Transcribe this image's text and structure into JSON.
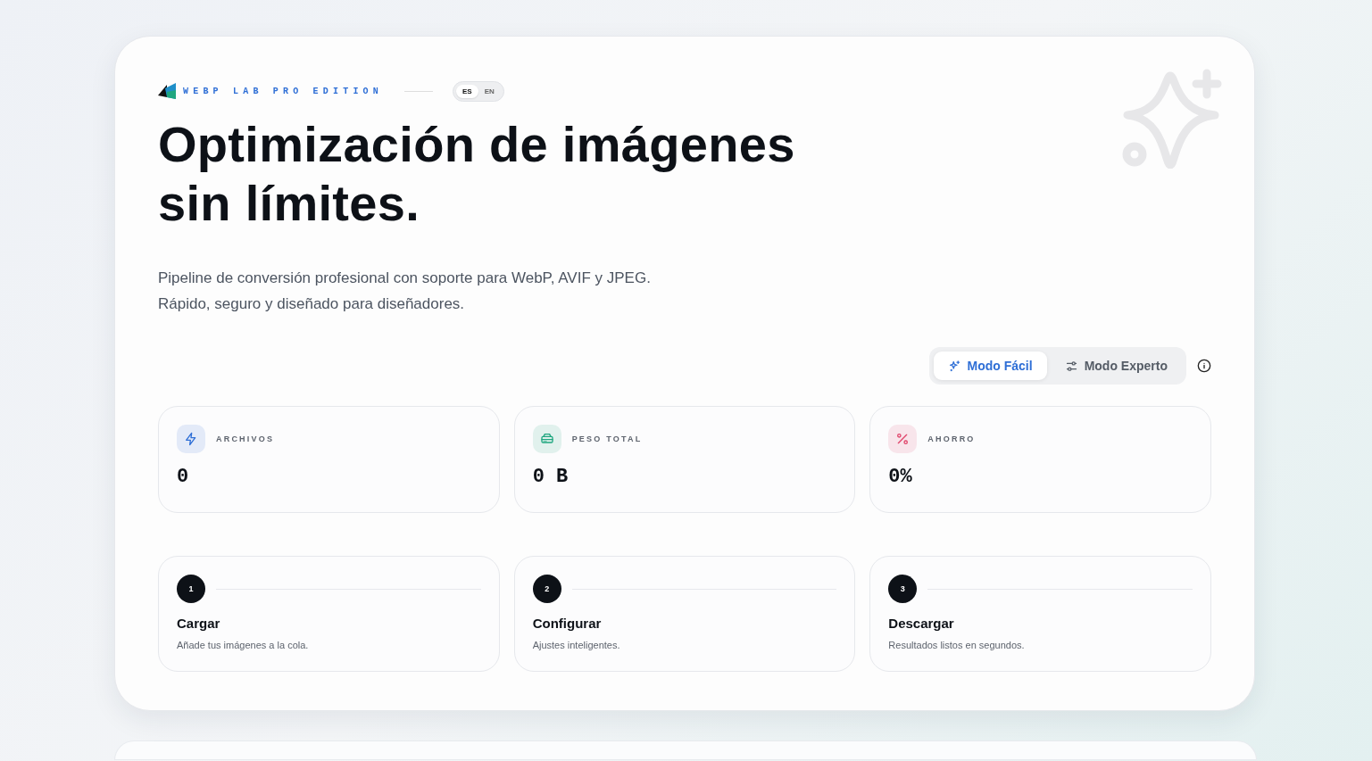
{
  "brand": {
    "name": "WEBP LAB PRO EDITION"
  },
  "languages": [
    {
      "label": "ES",
      "selected": true
    },
    {
      "label": "EN",
      "selected": false
    }
  ],
  "hero": {
    "title": "Optimización de imágenes sin límites.",
    "subtitle": "Pipeline de conversión profesional con soporte para WebP, AVIF y JPEG. Rápido, seguro y diseñado para diseñadores."
  },
  "modes": [
    {
      "label": "Modo Fácil",
      "kind": "sparkles",
      "selected": true
    },
    {
      "label": "Modo Experto",
      "kind": "sliders",
      "selected": false
    }
  ],
  "stats": [
    {
      "label": "ARCHIVOS",
      "value": "0",
      "kind": "bolt",
      "color": "#2f6fd6"
    },
    {
      "label": "PESO TOTAL",
      "value": "0 B",
      "kind": "drive",
      "color": "#1fa67f"
    },
    {
      "label": "AHORRO",
      "value": "0%",
      "kind": "percent",
      "color": "#e0456b"
    }
  ],
  "steps": [
    {
      "number": "1",
      "title": "Cargar",
      "description": "Añade tus imágenes a la cola."
    },
    {
      "number": "2",
      "title": "Configurar",
      "description": "Ajustes inteligentes."
    },
    {
      "number": "3",
      "title": "Descargar",
      "description": "Resultados listos en segundos."
    }
  ]
}
